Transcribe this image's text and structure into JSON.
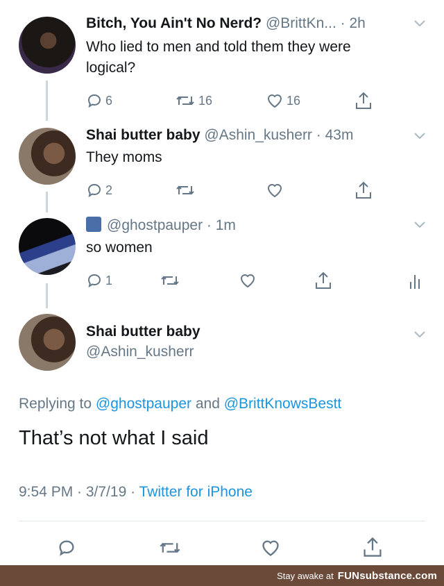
{
  "tweets": [
    {
      "name": "Bitch, You Ain't No Nerd?",
      "handle_time": "@BrittKn... · 2h",
      "text_lines": [
        "Who lied to men and told them they were",
        "logical?"
      ],
      "actions": {
        "replies": "6",
        "retweets": "16",
        "likes": "16"
      }
    },
    {
      "name": "Shai butter baby",
      "handle_time": "@Ashin_kusherr · 43m",
      "text": "They moms",
      "actions": {
        "replies": "2",
        "retweets": "",
        "likes": ""
      }
    },
    {
      "name": "",
      "handle_time": "@ghostpauper · 1m",
      "text": "so women",
      "actions": {
        "replies": "1",
        "retweets": "",
        "likes": ""
      }
    }
  ],
  "focused": {
    "name": "Shai butter baby",
    "handle": "@Ashin_kusherr",
    "replying_prefix": "Replying to ",
    "replying_mention1": "@ghostpauper",
    "replying_and": " and ",
    "replying_mention2": "@BrittKnowsBestt",
    "text": "That’s not what I said",
    "timestamp": "9:54 PM · 3/7/19 · ",
    "source": "Twitter for iPhone"
  },
  "footer": {
    "prefix": "Stay awake at",
    "brand": "FUNsubstance.com"
  },
  "colors": {
    "icon_gray": "#657786",
    "link_blue": "#1b95e0",
    "footer_bg": "#6c4a3a"
  }
}
